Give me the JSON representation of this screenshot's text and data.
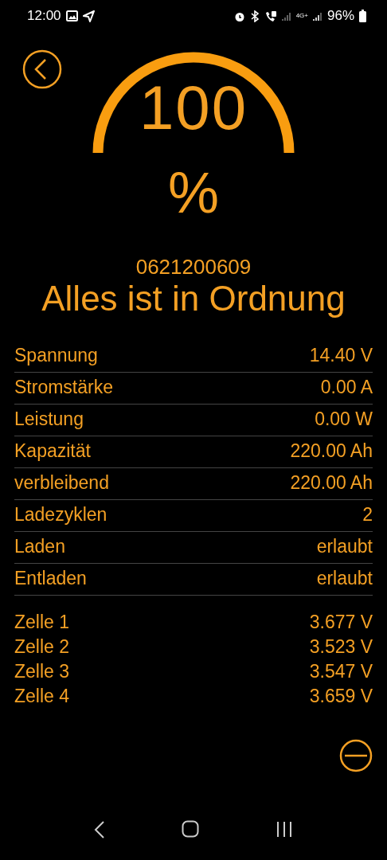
{
  "status_bar": {
    "time": "12:00",
    "network": "4G+",
    "battery": "96%"
  },
  "gauge": {
    "value": "100",
    "unit": "%"
  },
  "device_id": "0621200609",
  "status_message": "Alles ist in Ordnung",
  "metrics": [
    {
      "label": "Spannung",
      "value": "14.40 V"
    },
    {
      "label": "Stromstärke",
      "value": "0.00 A"
    },
    {
      "label": "Leistung",
      "value": "0.00 W"
    },
    {
      "label": "Kapazität",
      "value": "220.00 Ah"
    },
    {
      "label": "verbleibend",
      "value": "220.00 Ah"
    },
    {
      "label": "Ladezyklen",
      "value": "2"
    },
    {
      "label": "Laden",
      "value": "erlaubt"
    },
    {
      "label": "Entladen",
      "value": "erlaubt"
    }
  ],
  "cells": [
    {
      "label": "Zelle 1",
      "value": "3.677 V"
    },
    {
      "label": "Zelle 2",
      "value": "3.523 V"
    },
    {
      "label": "Zelle 3",
      "value": "3.547 V"
    },
    {
      "label": "Zelle 4",
      "value": "3.659 V"
    }
  ]
}
